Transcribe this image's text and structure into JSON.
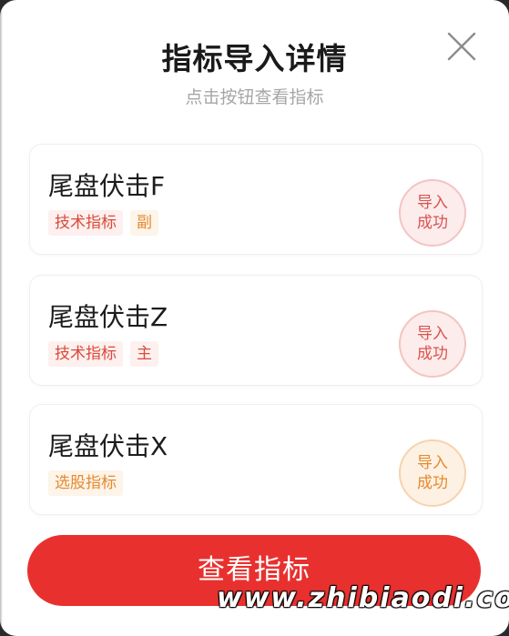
{
  "dialog": {
    "title": "指标导入详情",
    "subtitle": "点击按钮查看指标",
    "close_icon": "close-icon"
  },
  "items": [
    {
      "name": "尾盘伏击F",
      "tags": [
        {
          "label": "技术指标",
          "tone": "red"
        },
        {
          "label": "副",
          "tone": "orange"
        }
      ],
      "status_line1": "导入",
      "status_line2": "成功",
      "status_color": "#d9534f"
    },
    {
      "name": "尾盘伏击Z",
      "tags": [
        {
          "label": "技术指标",
          "tone": "red"
        },
        {
          "label": "主",
          "tone": "red"
        }
      ],
      "status_line1": "导入",
      "status_line2": "成功",
      "status_color": "#d9534f"
    },
    {
      "name": "尾盘伏击X",
      "tags": [
        {
          "label": "选股指标",
          "tone": "orange"
        }
      ],
      "status_line1": "导入",
      "status_line2": "成功",
      "status_color": "#e58a2e"
    }
  ],
  "footer": {
    "button_label": "查看指标"
  },
  "watermark": "www.zhibiaodi.com",
  "colors": {
    "accent": "#e8312f",
    "tag_red": "#d94a3b",
    "tag_orange": "#e58a2e"
  }
}
